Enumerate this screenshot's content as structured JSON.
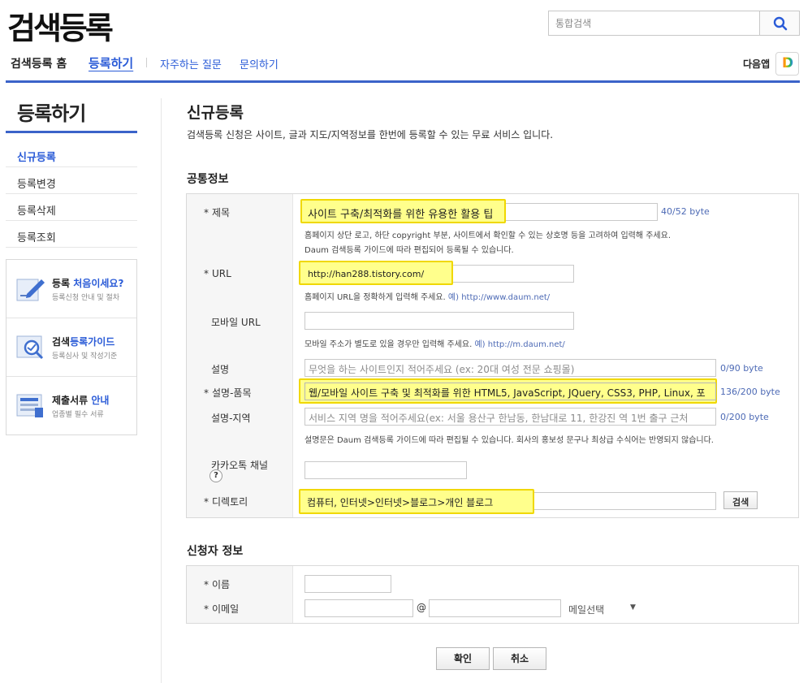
{
  "header": {
    "logo": "검색등록",
    "search_placeholder": "통합검색"
  },
  "topnav": {
    "home": "검색등록 홈",
    "register": "등록하기",
    "faq": "자주하는 질문",
    "contact": "문의하기",
    "daum_app": "다음앱",
    "daum_badge": "D"
  },
  "sidebar": {
    "title": "등록하기",
    "items": [
      {
        "label": "신규등록",
        "active": true
      },
      {
        "label": "등록변경",
        "active": false
      },
      {
        "label": "등록삭제",
        "active": false
      },
      {
        "label": "등록조회",
        "active": false
      }
    ],
    "promos": [
      {
        "prefix": "등록 ",
        "accent": "처음이세요?",
        "suffix": "",
        "sub": "등록신청 안내 및 절차"
      },
      {
        "prefix": "검색",
        "accent": "등록가이드",
        "suffix": "",
        "sub": "등록심사 및 작성기준"
      },
      {
        "prefix": "제출서류 ",
        "accent": "안내",
        "suffix": "",
        "sub": "업종별 필수 서류"
      }
    ]
  },
  "main": {
    "title": "신규등록",
    "desc": "검색등록 신청은 사이트, 글과 지도/지역정보를 한번에 등록할 수 있는 무료 서비스 입니다.",
    "section_common": "공통정보",
    "section_applicant": "신청자 정보",
    "fields": {
      "title": {
        "label": "제목",
        "value": "사이트 구축/최적화를 위한 유용한 활용 팁",
        "byte": "40/52 byte",
        "hint1": "홈페이지 상단 로고, 하단 copyright 부분, 사이트에서 확인할 수 있는 상호명 등을 고려하여 입력해 주세요.",
        "hint2": "Daum 검색등록 가이드에 따라 편집되어 등록될 수 있습니다."
      },
      "url": {
        "label": "URL",
        "value": "http://han288.tistory.com/",
        "hint": "홈페이지 URL을 정확하게 입력해 주세요.",
        "example": "예) http://www.daum.net/"
      },
      "mobile_url": {
        "label": "모바일 URL",
        "value": "",
        "hint": "모바일 주소가 별도로 있을 경우만 입력해 주세요.",
        "example": "예) http://m.daum.net/"
      },
      "desc": {
        "label": "설명",
        "placeholder": "무엇을 하는 사이트인지 적어주세요 (ex: 20대 여성 전문 쇼핑몰)",
        "byte": "0/90 byte"
      },
      "desc_item": {
        "label": "설명-품목",
        "value": "웹/모바일 사이트 구축 및 최적화를 위한 HTML5, JavaScript, JQuery, CSS3, PHP, Linux, 포",
        "byte": "136/200 byte"
      },
      "desc_region": {
        "label": "설명-지역",
        "placeholder": "서비스 지역 명을 적어주세요(ex: 서울  용산구 한남동, 한남대로 11, 한강진 역 1번 출구 근처",
        "byte": "0/200 byte",
        "hint": "설명문은 Daum 검색등록 가이드에 따라 편집될 수 있습니다. 회사의 홍보성 문구나 최상급 수식어는 반영되지 않습니다."
      },
      "kakao": {
        "label": "카카오톡 채널",
        "help": "?"
      },
      "directory": {
        "label": "디렉토리",
        "value": "컴퓨터, 인터넷>인터넷>블로그>개인 블로그",
        "button": "검색"
      }
    },
    "applicant": {
      "name_label": "이름",
      "email_label": "이메일",
      "at": "@",
      "mail_select": "메일선택",
      "arrow": "▼"
    },
    "required_mark": "*",
    "buttons": {
      "ok": "확인",
      "cancel": "취소"
    }
  }
}
